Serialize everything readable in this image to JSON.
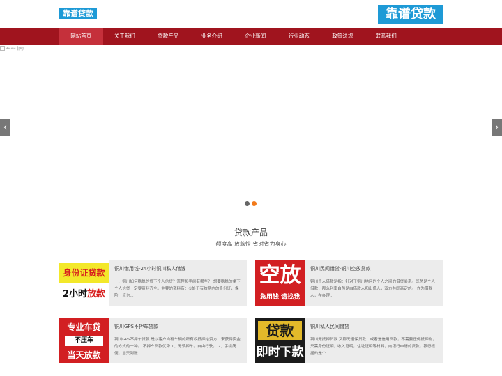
{
  "header": {
    "logo_small": "靠谱贷款",
    "logo_big": "靠谱贷款"
  },
  "nav": [
    {
      "label": "网站首页",
      "active": true
    },
    {
      "label": "关于我们"
    },
    {
      "label": "贷款产品"
    },
    {
      "label": "业务介绍"
    },
    {
      "label": "企业新闻"
    },
    {
      "label": "行业动态"
    },
    {
      "label": "政策法规"
    },
    {
      "label": "联系我们"
    }
  ],
  "banner": {
    "image_alt": "aaaa.jpg",
    "prev": "‹",
    "next": "›",
    "dot_count": 2,
    "active_dot": 2
  },
  "products": {
    "title": "贷款产品",
    "subtitle": "额度高 放款快 省时省力身心",
    "items": [
      {
        "title": "铜川借用钱-24小时铜川私人借钱",
        "desc": "一、铜川如何稳稳的贷下个人信贷？流程和手续有哪些？ 想要稳稳的拿下个人信贷一定要资料齐全。主要的资料有：①处于有效期内的身份证，保险一点也...",
        "thumb": {
          "line1": "身份证贷款",
          "line2a": "2小时",
          "line2b": "放款"
        }
      },
      {
        "title": "铜川民间借贷-铜川空放贷款",
        "desc": "铜川个人借款是指：针对于铜川地区的个人之间的借贷关系。既然是个人借款，那么利率自然是由借款人和出借人，双方共同商定的。 作为借款人，在办理...",
        "thumb": {
          "line1": "空放",
          "line2": "急用钱 请找我"
        }
      },
      {
        "title": "铜川GPS不押车贷款",
        "desc": "铜川GPS不押车贷款 是以客户自有车辆的所有权抵押给资方，来获得资金的方式的一种。 不押车贷款优势 1、无须押车。自由行驶。 2、手续简便，当天到账...",
        "thumb": {
          "line1": "专业车贷",
          "line2": "不压车",
          "line3": "当天放款"
        }
      },
      {
        "title": "铜川私人民间借贷",
        "desc": "铜川无抵押贷款 又称无担保贷款，或者是信用贷款，不需要任何抵押物，只需身份证明，收入证明，住址证明等材料，向银行申请的贷款，银行根据的是个...",
        "thumb": {
          "line1": "贷款",
          "line2": "即时下款"
        }
      }
    ]
  }
}
